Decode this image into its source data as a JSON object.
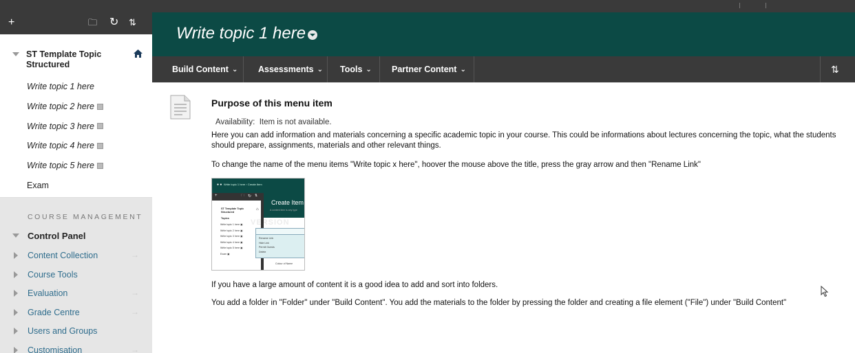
{
  "sidebar": {
    "toolbar": {
      "add": "+",
      "folder": "🗀",
      "refresh": "↻",
      "sort": "⇅"
    },
    "course_title": "ST Template Topic Structured",
    "menu_items": [
      {
        "label": "Write topic 1 here",
        "hidden": false
      },
      {
        "label": "Write topic 2 here",
        "hidden": true
      },
      {
        "label": "Write topic 3 here",
        "hidden": true
      },
      {
        "label": "Write topic 4 here",
        "hidden": true
      },
      {
        "label": "Write topic 5 here",
        "hidden": true
      },
      {
        "label": "Exam",
        "hidden": false
      }
    ],
    "course_management": {
      "heading": "COURSE MANAGEMENT",
      "control_panel": "Control Panel",
      "items": [
        {
          "label": "Content Collection",
          "arrow": "→"
        },
        {
          "label": "Course Tools",
          "arrow": ""
        },
        {
          "label": "Evaluation",
          "arrow": "→"
        },
        {
          "label": "Grade Centre",
          "arrow": "→"
        },
        {
          "label": "Users and Groups",
          "arrow": ""
        },
        {
          "label": "Customisation",
          "arrow": "→"
        }
      ]
    }
  },
  "header": {
    "title": "Write topic 1 here"
  },
  "action_bar": {
    "items": [
      "Build Content",
      "Assessments",
      "Tools",
      "Partner Content"
    ],
    "chevron": "⌄",
    "sort": "⇅"
  },
  "content": {
    "item_title": "Purpose of this menu item",
    "availability_label": "Availability:",
    "availability_value": "Item is not available.",
    "paragraph1": "Here you can add information and materials concerning a specific academic topic in your course. This could be informations about lectures concerning the topic, what the students should prepare, assignments, materials and other relevant things.",
    "paragraph2": "To change the name of the menu items \"Write topic x here\", hoover the mouse above the title, press the gray arrow and then \"Rename Link\"",
    "paragraph3": "If you have a large amount of content it is a good idea to add and sort into folders.",
    "paragraph4": "You add a folder in \"Folder\" under \"Build Content\". You add the materials to the folder by pressing the folder and creating a file element (\"File\") under \"Build Content\""
  },
  "thumbnail": {
    "breadcrumb": "Write topic 1 here › Create Item",
    "dots": "● ●",
    "toolbar": {
      "add": "+",
      "folder": "🗀",
      "refresh": "↻",
      "sort": "⇅"
    },
    "create_item": "Create Item",
    "create_sub": "A content item is any type",
    "course_title": "ST Template Topic Structured",
    "home": "⌂",
    "topics": "Topics",
    "items": [
      "Write topic 1 here ▣",
      "Write topic 2 here ▣",
      "Write topic 3 here ▣",
      "Write topic 4 here ▣",
      "Write topic 5 here ▣",
      "Exam ▣"
    ],
    "popup_items": [
      "Rename Link",
      "Hide Link",
      "Permit Guests",
      "Delete"
    ],
    "colour_label": "Colour of Name",
    "watermark": "VERSION"
  },
  "colors": {
    "header_bg": "#0c4a45",
    "bar_bg": "#3a3a3a",
    "link": "#2e6c8c"
  }
}
